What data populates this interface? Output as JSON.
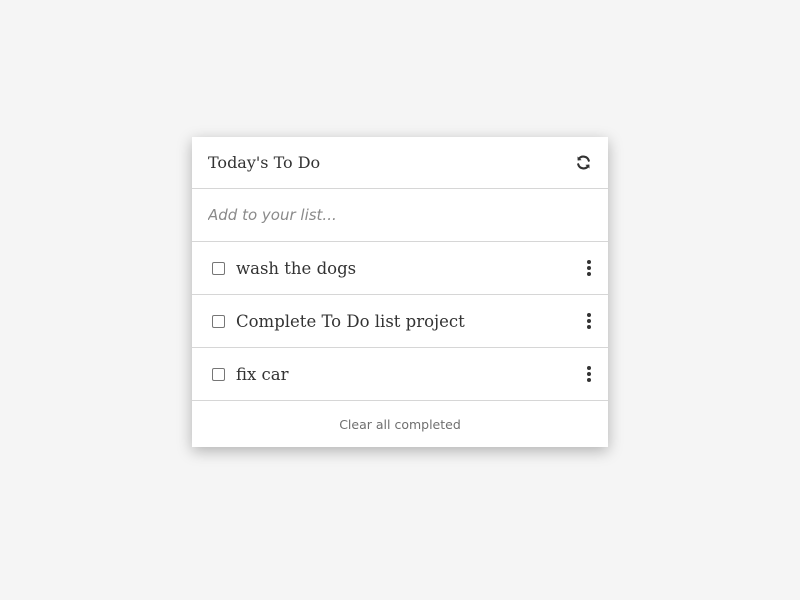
{
  "header": {
    "title": "Today's To Do",
    "refresh_icon": "refresh-icon"
  },
  "add_input": {
    "placeholder": "Add to your list...",
    "value": ""
  },
  "items": [
    {
      "label": "wash the dogs",
      "checked": false,
      "menu_icon": "kebab-menu-icon"
    },
    {
      "label": "Complete To Do list project",
      "checked": false,
      "menu_icon": "kebab-menu-icon"
    },
    {
      "label": "fix car",
      "checked": false,
      "menu_icon": "kebab-menu-icon"
    }
  ],
  "footer": {
    "clear_label": "Clear all completed"
  },
  "colors": {
    "background": "#f5f5f5",
    "card": "#ffffff",
    "text": "#333333",
    "muted": "#6f6f6f",
    "divider": "#d6d6d6"
  }
}
